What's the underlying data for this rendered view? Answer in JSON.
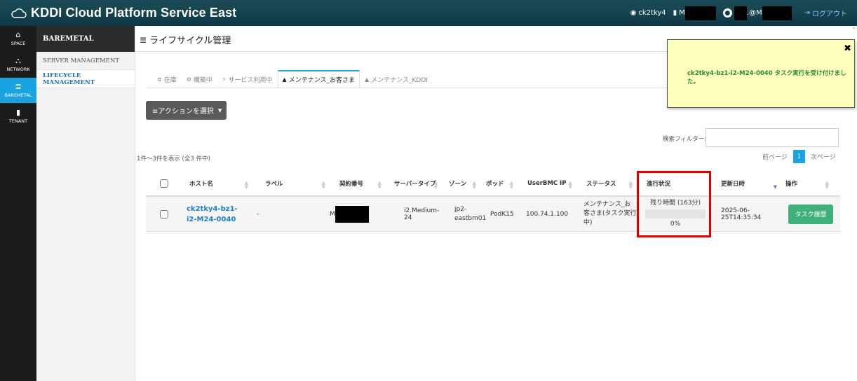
{
  "header": {
    "brand": "KDDI Cloud Platform Service East",
    "tenant": "ck2tky4",
    "org_prefix": "M",
    "user_suffix": ".@M",
    "logout": "ログアウト"
  },
  "icon_nav": [
    {
      "label": "SPACE",
      "icon": "home-icon",
      "glyph": "⌂"
    },
    {
      "label": "NETWORK",
      "icon": "network-icon",
      "glyph": "⛬"
    },
    {
      "label": "BAREMETAL",
      "icon": "server-icon",
      "glyph": "≣"
    },
    {
      "label": "TENANT",
      "icon": "building-icon",
      "glyph": "▮"
    }
  ],
  "subnav": {
    "title": "BAREMETAL",
    "items": [
      "SERVER MANAGEMENT",
      "LIFECYCLE MANAGEMENT"
    ]
  },
  "page": {
    "title": "ライフサイクル管理",
    "tabs": [
      {
        "label": "在庫",
        "glyph": "≣"
      },
      {
        "label": "構築中",
        "glyph": "⚙"
      },
      {
        "label": "サービス利用中",
        "glyph": "⚡"
      },
      {
        "label": "メンテナンス_お客さま",
        "glyph": "▲"
      },
      {
        "label": "メンテナンス_KDDI",
        "glyph": "▲"
      }
    ],
    "action_button": "≡アクションを選択",
    "filter_label": "検索フィルター:",
    "filter_value": "",
    "count_info": "1件～3件を表示 (全3 件中)",
    "pager": {
      "prev": "前ページ",
      "current": "1",
      "next": "次ページ"
    }
  },
  "table": {
    "columns": [
      "ホスト名",
      "ラベル",
      "契約番号",
      "サーバータイプ",
      "ゾーン",
      "ポッド",
      "UserBMC IP",
      "ステータス",
      "進行状況",
      "更新日時",
      "操作"
    ],
    "rows": [
      {
        "host": "ck2tky4-bz1-i2-M24-0040",
        "label": "-",
        "contract_prefix": "M",
        "server_type": "i2.Medium-24",
        "zone": "jp2-eastbm01",
        "pod": "PodK15",
        "bmc_ip": "100.74.1.100",
        "status": "メンテナンス_お客さま(タスク実行中)",
        "progress_label": "残り時間 (163分)",
        "progress_value": 0,
        "progress_pct": "0%",
        "updated": "2025-06-25T14:35:34",
        "action": "タスク履歴"
      }
    ]
  },
  "notification": {
    "message": "ck2tky4-bz1-i2-M24-0040 タスク実行を受け付けました。",
    "close": "✖"
  },
  "colors": {
    "accent": "#1aa3e0",
    "header": "#0f3845",
    "success": "#3fb07a",
    "highlight": "#e00000",
    "notify_bg": "#ffffc0"
  }
}
